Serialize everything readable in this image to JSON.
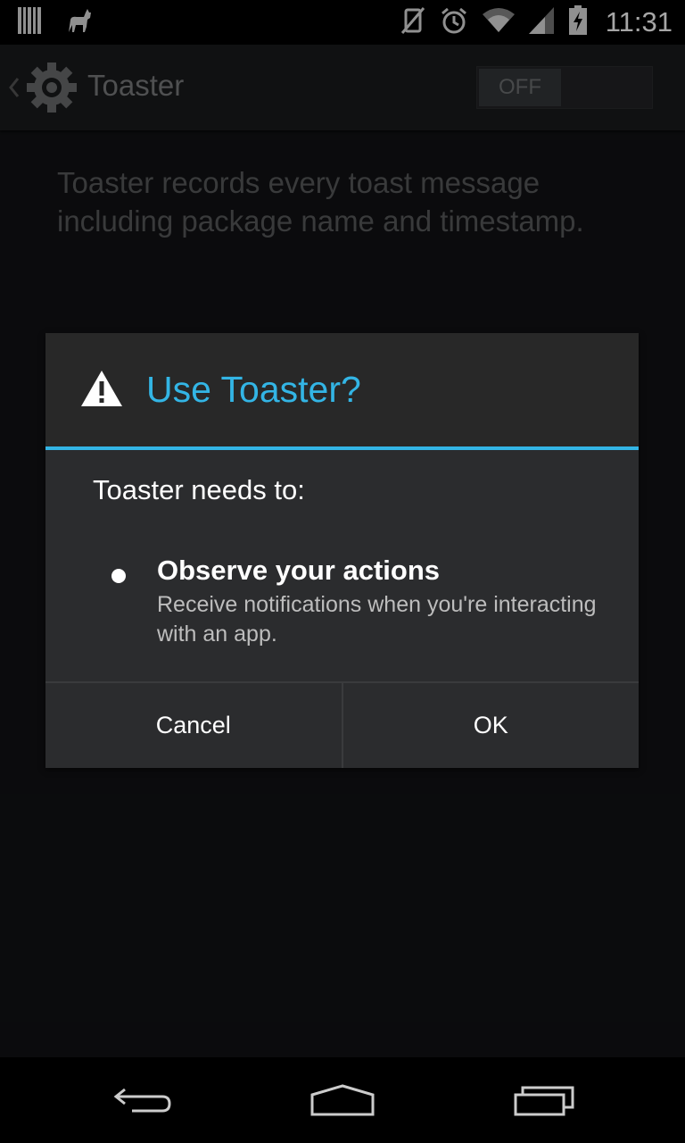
{
  "status_bar": {
    "time": "11:31",
    "icons": [
      "barcode-icon",
      "cat-icon",
      "vibrate-off-icon",
      "alarm-icon",
      "wifi-icon",
      "signal-icon",
      "battery-charging-icon"
    ]
  },
  "action_bar": {
    "title": "Toaster",
    "toggle_label": "OFF"
  },
  "description": "Toaster records every toast message including package name and timestamp.",
  "dialog": {
    "title": "Use Toaster?",
    "needs_label": "Toaster needs to:",
    "permission": {
      "title": "Observe your actions",
      "description": "Receive notifications when you're interacting with an app."
    },
    "cancel_label": "Cancel",
    "ok_label": "OK",
    "accent_color": "#33b5e5"
  },
  "nav_bar": {
    "icons": [
      "back-icon",
      "home-icon",
      "recents-icon"
    ]
  }
}
